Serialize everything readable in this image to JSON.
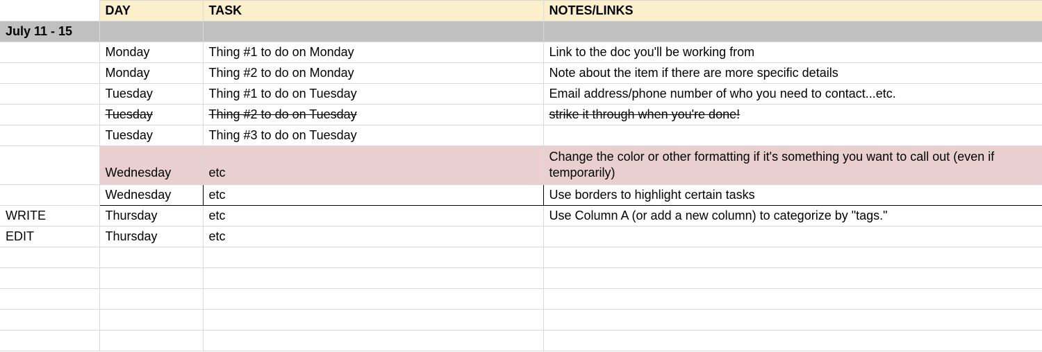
{
  "headers": {
    "colA": "",
    "day": "DAY",
    "task": "TASK",
    "notes": "NOTES/LINKS"
  },
  "dateRange": "July 11 - 15",
  "rows": [
    {
      "tag": "",
      "day": "Monday",
      "task": "Thing #1 to do on Monday",
      "notes": "Link to the doc you'll be working from",
      "strike": false,
      "pink": false,
      "bordered": false
    },
    {
      "tag": "",
      "day": "Monday",
      "task": "Thing #2 to do on Monday",
      "notes": "Note about the item if there are more specific details",
      "strike": false,
      "pink": false,
      "bordered": false
    },
    {
      "tag": "",
      "day": "Tuesday",
      "task": "Thing #1 to do on Tuesday",
      "notes": "Email address/phone number of who you need to contact...etc.",
      "strike": false,
      "pink": false,
      "bordered": false
    },
    {
      "tag": "",
      "day": "Tuesday",
      "task": "Thing #2 to do on Tuesday",
      "notes": "strike it through when you're done!",
      "strike": true,
      "pink": false,
      "bordered": false
    },
    {
      "tag": "",
      "day": "Tuesday",
      "task": "Thing #3 to do on Tuesday",
      "notes": "",
      "strike": false,
      "pink": false,
      "bordered": false
    },
    {
      "tag": "",
      "day": "Wednesday",
      "task": "etc",
      "notes": "Change the color or other formatting if it's something you want to call out (even if temporarily)",
      "strike": false,
      "pink": true,
      "bordered": false
    },
    {
      "tag": "",
      "day": "Wednesday",
      "task": "etc",
      "notes": "Use borders to highlight certain tasks",
      "strike": false,
      "pink": false,
      "bordered": true
    },
    {
      "tag": "WRITE",
      "day": "Thursday",
      "task": "etc",
      "notes": "Use Column A (or add a new column) to categorize by \"tags.\"",
      "strike": false,
      "pink": false,
      "bordered": false
    },
    {
      "tag": "EDIT",
      "day": "Thursday",
      "task": "etc",
      "notes": "",
      "strike": false,
      "pink": false,
      "bordered": false
    },
    {
      "tag": "",
      "day": "",
      "task": "",
      "notes": "",
      "strike": false,
      "pink": false,
      "bordered": false
    },
    {
      "tag": "",
      "day": "",
      "task": "",
      "notes": "",
      "strike": false,
      "pink": false,
      "bordered": false
    },
    {
      "tag": "",
      "day": "",
      "task": "",
      "notes": "",
      "strike": false,
      "pink": false,
      "bordered": false
    },
    {
      "tag": "",
      "day": "",
      "task": "",
      "notes": "",
      "strike": false,
      "pink": false,
      "bordered": false
    },
    {
      "tag": "",
      "day": "",
      "task": "",
      "notes": "",
      "strike": false,
      "pink": false,
      "bordered": false
    }
  ]
}
